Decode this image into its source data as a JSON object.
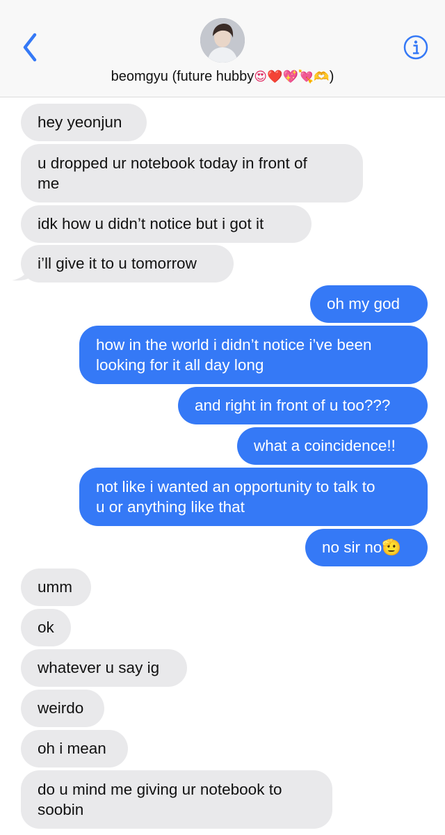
{
  "header": {
    "contact_name": "beomgyu (future hubby",
    "contact_emojis": "😍❤️💖💘🫶",
    "contact_suffix": ")"
  },
  "messages": [
    {
      "from": "them",
      "text": "hey yeonjun"
    },
    {
      "from": "them",
      "lines": [
        "u dropped ur notebook today in front of",
        "me"
      ]
    },
    {
      "from": "them",
      "text": "idk how u didn’t notice but i got it"
    },
    {
      "from": "them",
      "text": "i’ll give it to u tomorrow"
    },
    {
      "from": "me",
      "text": "oh my god"
    },
    {
      "from": "me",
      "lines": [
        "how in the world i didn’t notice i’ve been",
        "looking for it all day long"
      ]
    },
    {
      "from": "me",
      "text": "and right in front of u too???"
    },
    {
      "from": "me",
      "text": "what a coincidence!!"
    },
    {
      "from": "me",
      "lines": [
        "not like i wanted an opportunity to talk to",
        "u or anything like that"
      ]
    },
    {
      "from": "me",
      "text": "no sir no🫡"
    },
    {
      "from": "them",
      "text": "umm"
    },
    {
      "from": "them",
      "text": "ok"
    },
    {
      "from": "them",
      "text": "whatever u say ig"
    },
    {
      "from": "them",
      "text": "weirdo"
    },
    {
      "from": "them",
      "text": "oh i mean"
    },
    {
      "from": "them",
      "lines": [
        "do u mind me giving ur notebook to",
        "soobin"
      ]
    }
  ],
  "colors": {
    "accent": "#3579f6",
    "incoming_bubble": "#e9e9eb",
    "header_bg": "#f8f8f8"
  },
  "icons": {
    "back": "chevron-left-icon",
    "info": "info-icon"
  }
}
